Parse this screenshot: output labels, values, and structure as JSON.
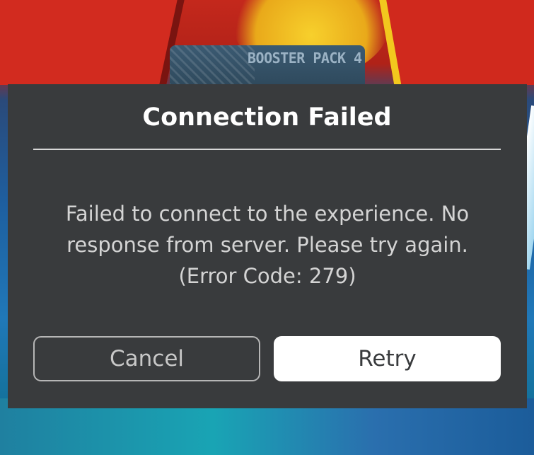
{
  "background": {
    "banner_text": "BOOSTER PACK 4"
  },
  "dialog": {
    "title": "Connection Failed",
    "message_lines": [
      "Failed to connect to the experience. No",
      "response from server. Please try again.",
      "(Error Code: 279)"
    ],
    "cancel_label": "Cancel",
    "retry_label": "Retry"
  },
  "colors": {
    "dialog_background": "#393b3d",
    "primary_button": "#ffffff",
    "secondary_button_border": "#b6b6b6"
  }
}
